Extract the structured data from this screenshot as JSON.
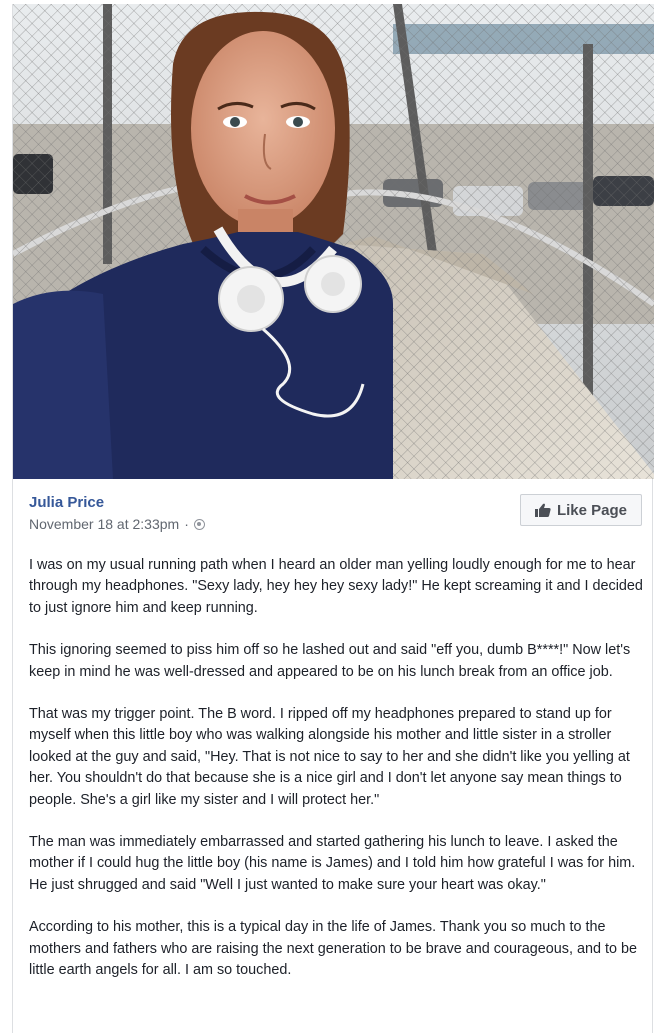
{
  "post": {
    "author": "Julia Price",
    "timestamp": "November 18 at 2:33pm",
    "separator": "·",
    "privacy_icon": "globe-icon",
    "like_page_label": "Like Page",
    "like_icon": "thumbs-up-icon",
    "photo_alt": "Selfie of woman with white headphones on a running path near the beach",
    "paragraphs": [
      "I was on my usual running path when I heard an older man yelling loudly enough for me to hear through my headphones. \"Sexy lady, hey hey hey sexy lady!\" He kept screaming it and I decided to just ignore him and keep running.",
      "This ignoring seemed to piss him off so he lashed out and said \"eff you, dumb B****!\" Now let's keep in mind he was well-dressed and appeared to be on his lunch break from an office job.",
      "That was my trigger point. The B word. I ripped off my headphones prepared to stand up for myself when this little boy who was walking alongside his mother and little sister in a stroller looked at the guy and said, \"Hey. That is not nice to say to her and she didn't like you yelling at her. You shouldn't do that because she is a nice girl and I don't let anyone say mean things to people. She's a girl like my sister and I will protect her.\"",
      "The man was immediately embarrassed and started gathering his lunch to leave. I asked the mother if I could hug the little boy (his name is James) and I told him how grateful I was for him. He just shrugged and said \"Well I just wanted to make sure your heart was okay.\"",
      "According to his mother, this is a typical day in the life of James. Thank you so much to the mothers and fathers who are raising the next generation to be brave and courageous, and to be little earth angels for all. I am so touched."
    ]
  },
  "colors": {
    "link_blue": "#365899",
    "meta_gray": "#616770",
    "text": "#1d2129",
    "jacket_navy": "#1f2a5c"
  }
}
